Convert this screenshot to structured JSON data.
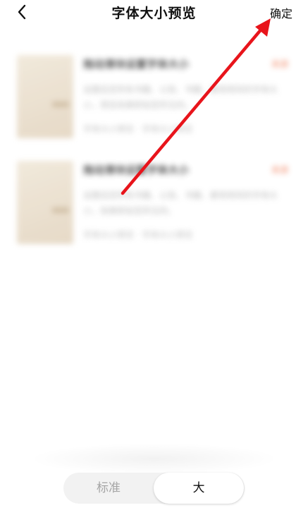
{
  "header": {
    "title": "字体大小预览",
    "confirm_label": "确定"
  },
  "preview": {
    "cards": [
      {
        "title": "拖动滑块设置字体大小",
        "tag": "来源",
        "description": "设置后您所有书籍、公告、书籍、都将用到的字体大小，预览效果即如您所见的。",
        "meta": "字体大小预览 · 字体大小预览"
      },
      {
        "title": "拖动滑块设置字体大小",
        "tag": "来源",
        "description": "设置后您所有书籍、公告、书籍、都将用到的字体大小，效果即如您所见的。",
        "meta": "字体大小预览 · 字体大小预览"
      }
    ]
  },
  "font_size_selector": {
    "options": [
      "标准",
      "大"
    ],
    "selected": "大"
  },
  "colors": {
    "accent": "#f07a55",
    "annotation_arrow": "#e8141b",
    "selected_text": "#111111",
    "unselected_text": "#a5a5a5"
  }
}
